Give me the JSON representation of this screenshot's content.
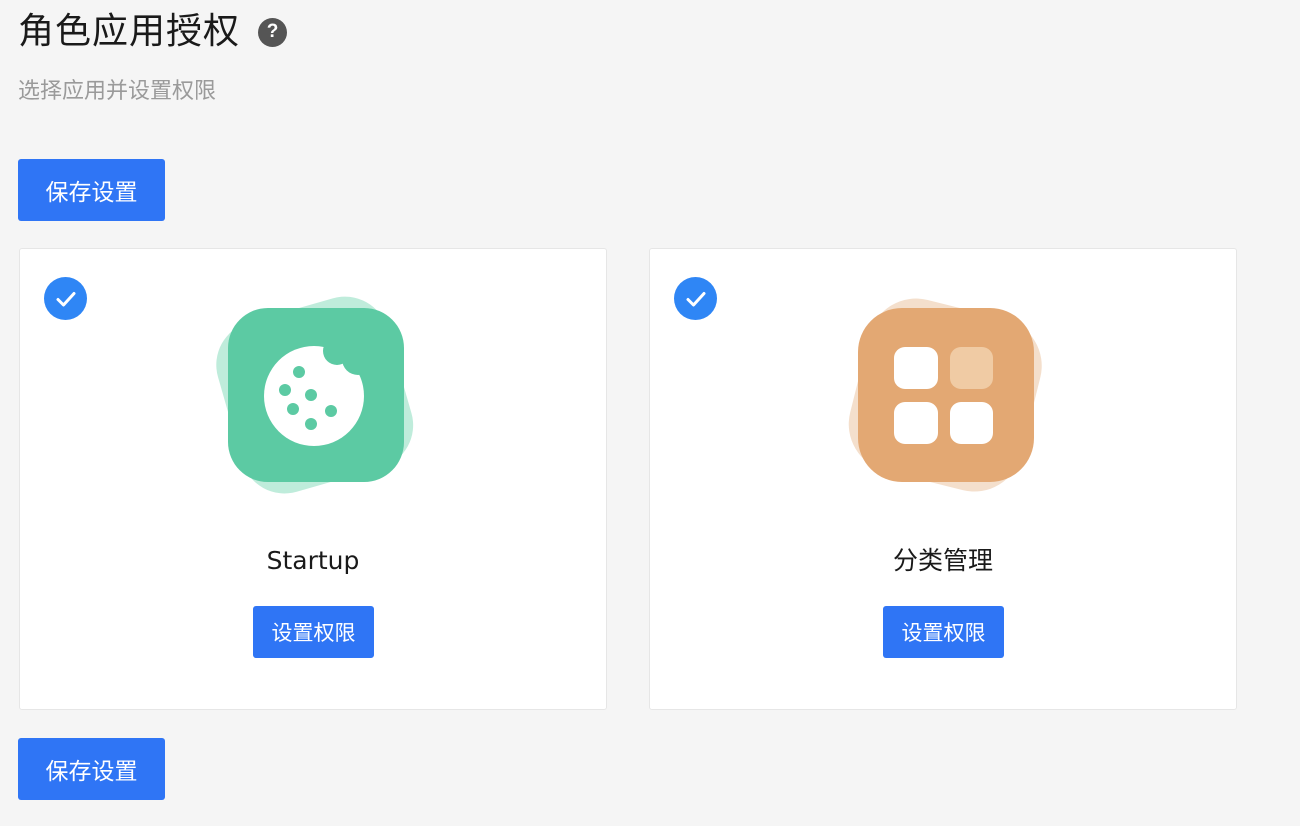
{
  "header": {
    "title": "角色应用授权",
    "help_icon": "question-circle-icon",
    "subtitle": "选择应用并设置权限"
  },
  "actions": {
    "save_label_top": "保存设置",
    "save_label_bottom": "保存设置"
  },
  "apps": [
    {
      "name": "Startup",
      "icon": "cookie-icon",
      "icon_color": "#5ccaa3",
      "selected": true,
      "permission_label": "设置权限"
    },
    {
      "name": "分类管理",
      "icon": "category-grid-icon",
      "icon_color": "#e3a873",
      "selected": true,
      "permission_label": "设置权限"
    }
  ],
  "colors": {
    "primary": "#2f75f5",
    "check": "#2f86f5",
    "background": "#f5f5f5"
  }
}
